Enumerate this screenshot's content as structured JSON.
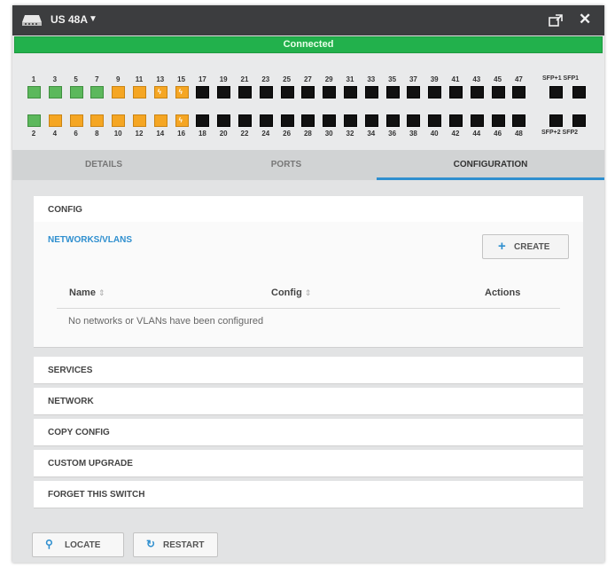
{
  "window": {
    "title": "US 48A",
    "title_caret": "▼",
    "close_glyph": "✕",
    "status": "Connected",
    "status_color": "#22b14c"
  },
  "ports": {
    "odd": [
      "1",
      "3",
      "5",
      "7",
      "9",
      "11",
      "13",
      "15",
      "17",
      "19",
      "21",
      "23",
      "25",
      "27",
      "29",
      "31",
      "33",
      "35",
      "37",
      "39",
      "41",
      "43",
      "45",
      "47"
    ],
    "even": [
      "2",
      "4",
      "6",
      "8",
      "10",
      "12",
      "14",
      "16",
      "18",
      "20",
      "22",
      "24",
      "26",
      "28",
      "30",
      "32",
      "34",
      "36",
      "38",
      "40",
      "42",
      "44",
      "46",
      "48"
    ],
    "odd_states": [
      "g",
      "g",
      "g",
      "g",
      "o",
      "o",
      "p",
      "p",
      "b",
      "b",
      "b",
      "b",
      "b",
      "b",
      "b",
      "b",
      "b",
      "b",
      "b",
      "b",
      "b",
      "b",
      "b",
      "b"
    ],
    "even_states": [
      "g",
      "o",
      "o",
      "o",
      "o",
      "o",
      "o",
      "p",
      "b",
      "b",
      "b",
      "b",
      "b",
      "b",
      "b",
      "b",
      "b",
      "b",
      "b",
      "b",
      "b",
      "b",
      "b",
      "b"
    ],
    "sfp_top": "SFP+1 SFP1",
    "sfp_bottom": "SFP+2 SFP2",
    "poe_glyph": "ϟ",
    "colors": {
      "up_1g": "#5cb85c",
      "up_100m": "#f5a623",
      "down": "#111111"
    }
  },
  "tabs": [
    {
      "label": "DETAILS"
    },
    {
      "label": "PORTS"
    },
    {
      "label": "CONFIGURATION"
    }
  ],
  "config": {
    "config_label": "CONFIG",
    "vlans": {
      "title": "NETWORKS/VLANS",
      "create_label": "CREATE",
      "create_icon": "+",
      "columns": {
        "name": "Name",
        "config": "Config",
        "actions": "Actions"
      },
      "sort_glyph": "⇕",
      "empty": "No networks or VLANs have been configured"
    },
    "sections": [
      "SERVICES",
      "NETWORK",
      "COPY CONFIG",
      "CUSTOM UPGRADE",
      "FORGET THIS SWITCH"
    ]
  },
  "footer": {
    "locate": "LOCATE",
    "restart": "RESTART",
    "locate_icon": "⚲",
    "restart_icon": "↻"
  },
  "accent_color": "#2f8fcf"
}
